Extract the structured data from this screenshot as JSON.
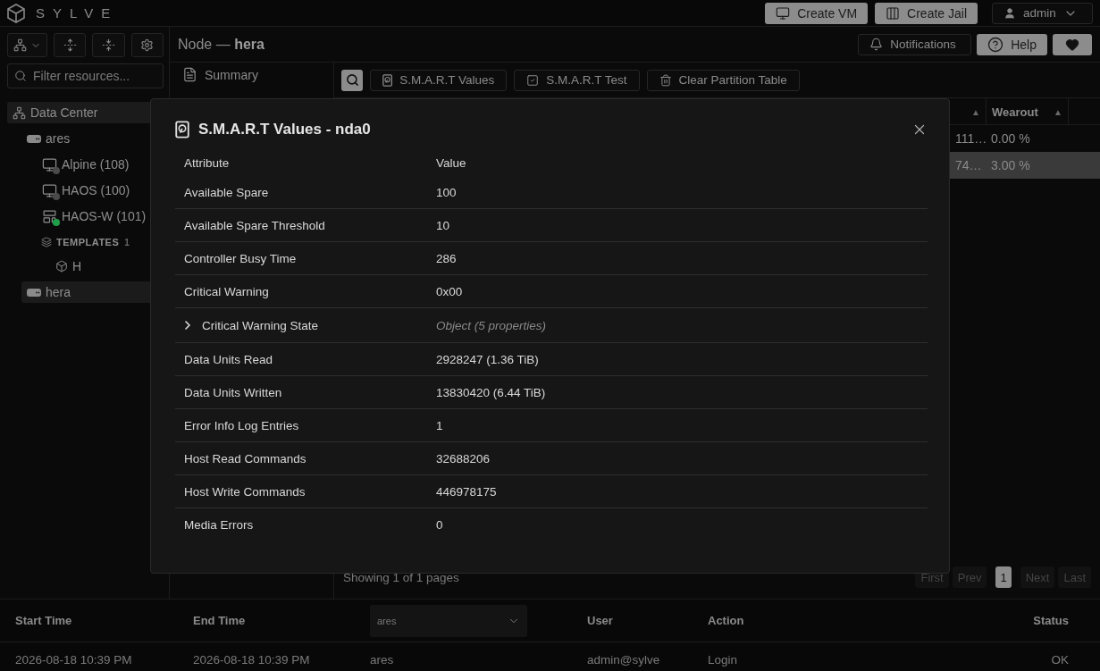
{
  "app": {
    "name": "SYLVE"
  },
  "top_actions": [
    {
      "kind": "vm",
      "label": "Create VM"
    },
    {
      "kind": "jail",
      "label": "Create Jail"
    }
  ],
  "user_menu": {
    "label": "admin"
  },
  "sidebar": {
    "filter": {
      "placeholder": "Filter resources..."
    },
    "tree": [
      {
        "kind": "datacenter",
        "label": "Data Center",
        "selected": true,
        "children": [
          {
            "kind": "node",
            "label": "ares",
            "selected": false,
            "children": [
              {
                "kind": "vm",
                "label": "Alpine (108)",
                "selected": false,
                "color": "#4a4a4a"
              },
              {
                "kind": "vm",
                "label": "HAOS (100)",
                "selected": false,
                "color": "#4a4a4a"
              },
              {
                "kind": "jail",
                "label": "HAOS-W (101)",
                "selected": false,
                "color": "#1f9d48"
              },
              {
                "kind": "group",
                "label": "TEMPLATES",
                "count": "1",
                "selected": false,
                "children": [
                  {
                    "kind": "template",
                    "label": "H",
                    "selected": false
                  }
                ]
              }
            ]
          },
          {
            "kind": "node",
            "label": "hera",
            "selected": true
          }
        ]
      }
    ]
  },
  "header": {
    "title": "Node — **hera**",
    "actions": [
      {
        "kind": "bell",
        "label": "Notifications"
      },
      {
        "kind": "help",
        "label": "Help"
      },
      {
        "kind": "heart"
      }
    ]
  },
  "nav": [
    {
      "kind": "summary",
      "label": "Summary"
    }
  ],
  "toolbar": [
    {
      "kind": "smart-values",
      "label": "S.M.A.R.T Values"
    },
    {
      "kind": "smart-test",
      "label": "S.M.A.R.T Test"
    },
    {
      "kind": "trash",
      "label": "Clear Partition Table"
    }
  ],
  "table": {
    "columns": [
      {
        "sort_icon": "▲"
      },
      {
        "label": "Wearout",
        "sort_icon": "▲"
      }
    ],
    "rows": [
      {
        "cells": [
          "111…",
          "0.00 %"
        ],
        "selected": false
      },
      {
        "cells": [
          "74…",
          "3.00 %"
        ],
        "selected": true
      }
    ]
  },
  "pagination": {
    "summary": "Showing 1 of 1 pages",
    "buttons": [
      {
        "label": "First",
        "selected": false,
        "disabled": true
      },
      {
        "label": "Prev",
        "selected": false,
        "disabled": true
      },
      {
        "label": "1",
        "selected": true,
        "disabled": false
      },
      {
        "label": "Next",
        "selected": false,
        "disabled": true
      },
      {
        "label": "Last",
        "selected": false,
        "disabled": true
      }
    ]
  },
  "log": {
    "columns": [
      {
        "kind": "text",
        "label": "Start Time"
      },
      {
        "kind": "text",
        "label": "End Time"
      },
      {
        "kind": "select",
        "value": "ares"
      },
      {
        "kind": "text",
        "label": "User"
      },
      {
        "kind": "text",
        "label": "Action"
      },
      {
        "kind": "text",
        "label": "Status"
      }
    ],
    "rows": [
      [
        "2026-08-18 10:39 PM",
        "2026-08-18 10:39 PM",
        "ares",
        "admin@sylve",
        "Login",
        "OK"
      ]
    ]
  },
  "modal": {
    "title": "S.M.A.R.T Values - nda0",
    "columns": [
      "Attribute",
      "Value"
    ],
    "rows": [
      {
        "kind": "value",
        "attribute": "Available Spare",
        "value": "100"
      },
      {
        "kind": "value",
        "attribute": "Available Spare Threshold",
        "value": "10"
      },
      {
        "kind": "value",
        "attribute": "Controller Busy Time",
        "value": "286"
      },
      {
        "kind": "value",
        "attribute": "Critical Warning",
        "value": "0x00"
      },
      {
        "kind": "object",
        "attribute": "Critical Warning State",
        "value": "Object (5 properties)",
        "expanded": false
      },
      {
        "kind": "value",
        "attribute": "Data Units Read",
        "value": "2928247 (1.36 TiB)"
      },
      {
        "kind": "value",
        "attribute": "Data Units Written",
        "value": "13830420 (6.44 TiB)"
      },
      {
        "kind": "value",
        "attribute": "Error Info Log Entries",
        "value": "1"
      },
      {
        "kind": "value",
        "attribute": "Host Read Commands",
        "value": "32688206"
      },
      {
        "kind": "value",
        "attribute": "Host Write Commands",
        "value": "446978175"
      },
      {
        "kind": "value",
        "attribute": "Media Errors",
        "value": "0"
      }
    ]
  }
}
